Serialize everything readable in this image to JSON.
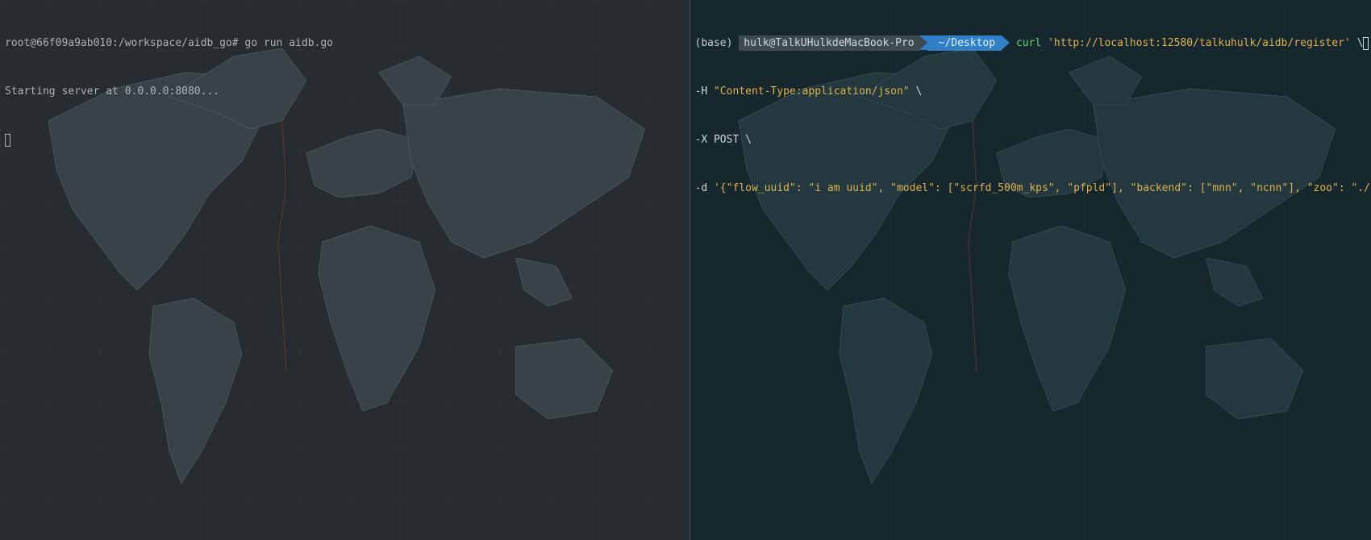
{
  "left_terminal": {
    "prompt": "root@66f09a9ab010:/workspace/aidb_go#",
    "command": "go run aidb.go",
    "output_line": "Starting server at 0.0.0.0:8080..."
  },
  "right_terminal": {
    "env": "(base)",
    "user_host": "hulk@TalkUHulkdeMacBook-Pro",
    "cwd": "~/Desktop",
    "command": "curl",
    "url_arg": "'http://localhost:12580/talkuhulk/aidb/register'",
    "continuation": "\\",
    "header_flag": "-H",
    "header_value": "\"Content-Type:application/json\"",
    "method_flag": "-X POST \\",
    "data_flag": "-d",
    "data_value": "'{\"flow_uuid\": \"i am uuid\", \"model\": [\"scrfd_500m_kps\", \"pfpld\"], \"backend\": [\"mnn\", \"ncnn\"], \"zoo\": \"./config\"}'"
  },
  "colors": {
    "left_bg": "#262c2f",
    "right_bg": "#16272d",
    "command_green": "#5fd36a",
    "string_yellow": "#e0b24a",
    "dir_segment_blue": "#2f80c8"
  }
}
